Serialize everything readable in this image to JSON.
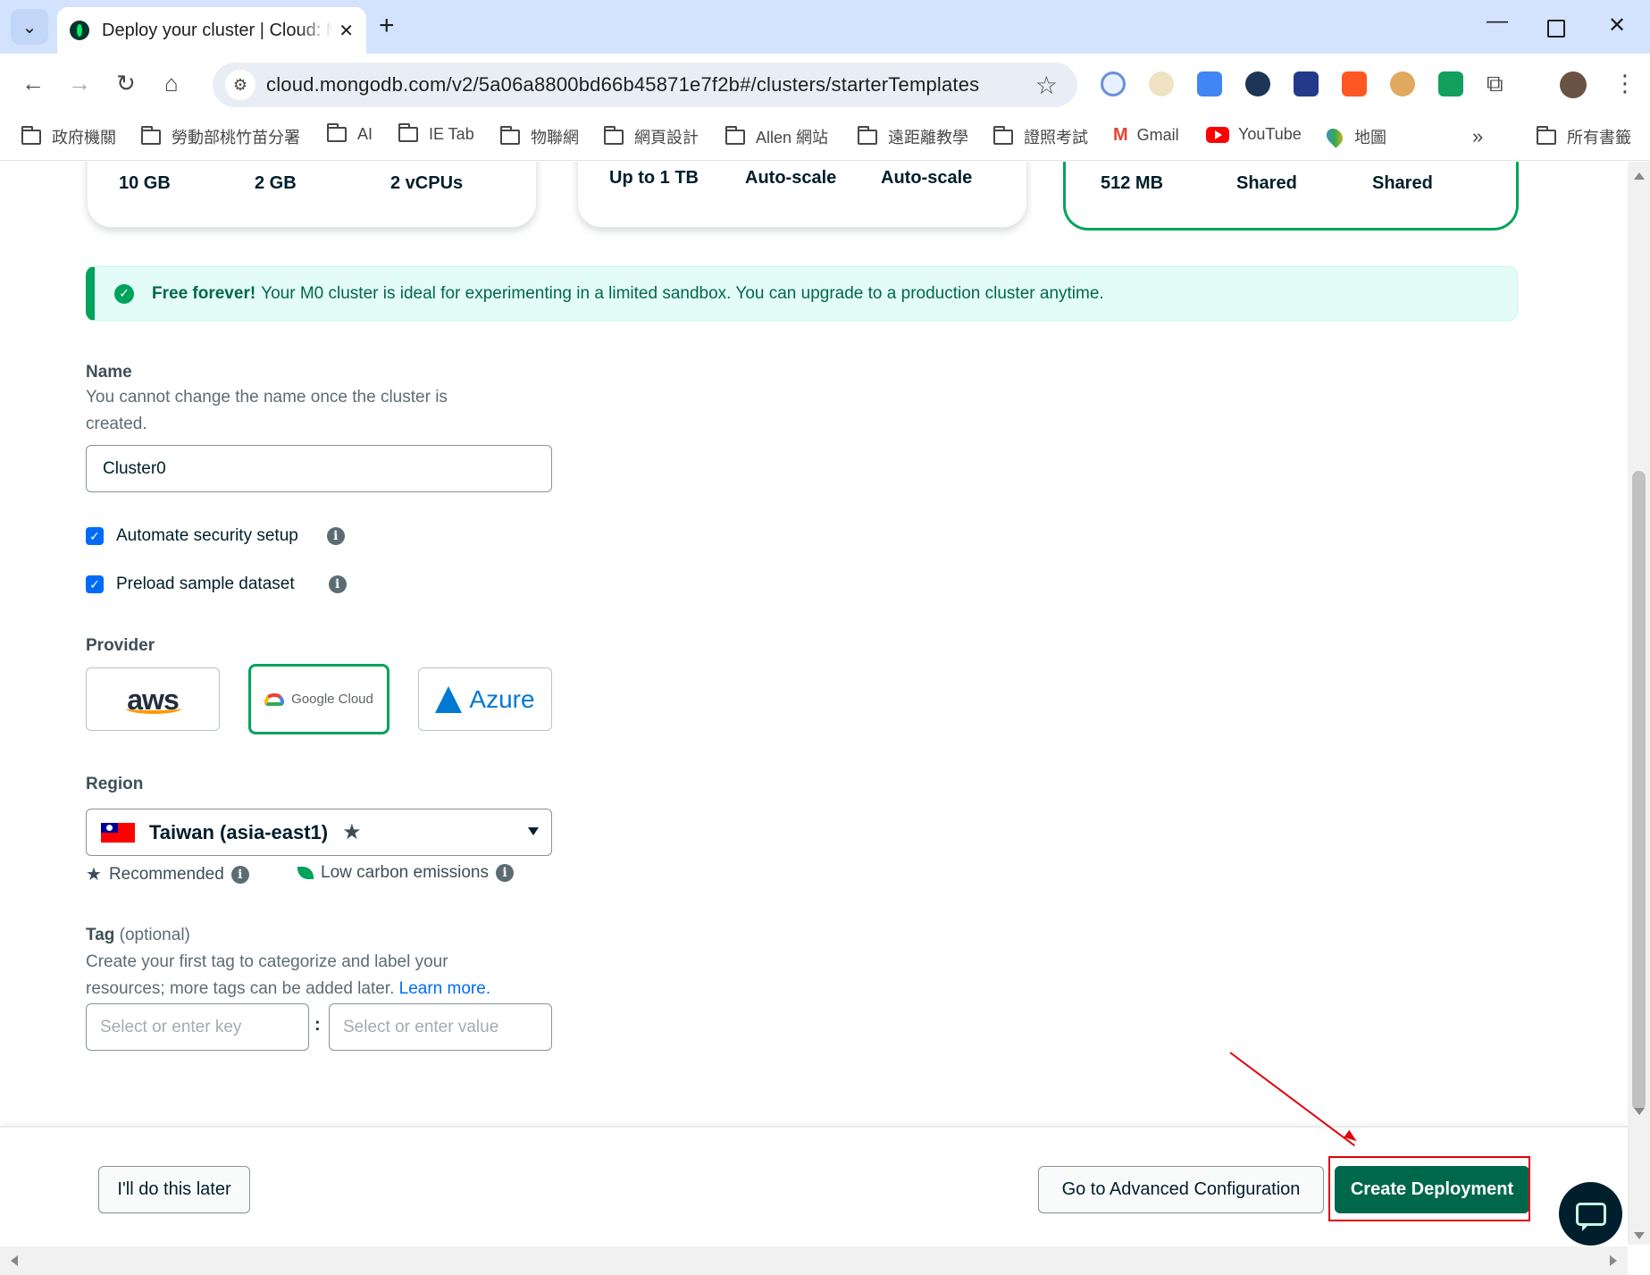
{
  "browser": {
    "tab_title": "Deploy your cluster | Cloud: MongoDB Cloud",
    "url": "cloud.mongodb.com/v2/5a06a8800bd66b45871e7f2b#/clusters/starterTemplates",
    "bookmarks": [
      "政府機關",
      "勞動部桃竹苗分署",
      "AI",
      "IE Tab",
      "物聯網",
      "網頁設計",
      "Allen 網站",
      "遠距離教學",
      "證照考試",
      "Gmail",
      "YouTube",
      "地圖"
    ],
    "all_bookmarks": "所有書籤",
    "more": "»"
  },
  "tiers": [
    {
      "specs": [
        "10 GB",
        "2 GB",
        "2 vCPUs"
      ]
    },
    {
      "specs": [
        "Up to 1 TB",
        "Auto-scale",
        "Auto-scale"
      ]
    },
    {
      "specs": [
        "512 MB",
        "Shared",
        "Shared"
      ],
      "selected": true
    }
  ],
  "banner": {
    "bold": "Free forever!",
    "text": "Your M0 cluster is ideal for experimenting in a limited sandbox. You can upgrade to a production cluster anytime."
  },
  "name_section": {
    "label": "Name",
    "desc_line1": "You cannot change the name once the cluster is",
    "desc_line2": "created.",
    "value": "Cluster0"
  },
  "options": [
    {
      "label": "Automate security setup",
      "checked": true
    },
    {
      "label": "Preload sample dataset",
      "checked": true
    }
  ],
  "provider_section": {
    "label": "Provider",
    "providers": [
      {
        "name": "aws",
        "selected": false
      },
      {
        "name": "Google Cloud",
        "selected": true
      },
      {
        "name": "Azure",
        "selected": false
      }
    ]
  },
  "region_section": {
    "label": "Region",
    "value": "Taiwan (asia-east1)",
    "recommended": "Recommended",
    "low_carbon": "Low carbon emissions"
  },
  "tag_section": {
    "label": "Tag",
    "optional": "(optional)",
    "desc_line1": "Create your first tag to categorize and label your",
    "desc_line2": "resources; more tags can be added later.",
    "learn_more": "Learn more.",
    "key_placeholder": "Select or enter key",
    "separator": ":",
    "value_placeholder": "Select or enter value"
  },
  "footer": {
    "later": "I'll do this later",
    "advanced": "Go to Advanced Configuration",
    "create": "Create Deployment"
  },
  "colors": {
    "primary_green": "#00684a",
    "selected_border": "#00a35c",
    "annotation_red": "#e2000d",
    "checkbox_blue": "#016bf8"
  }
}
